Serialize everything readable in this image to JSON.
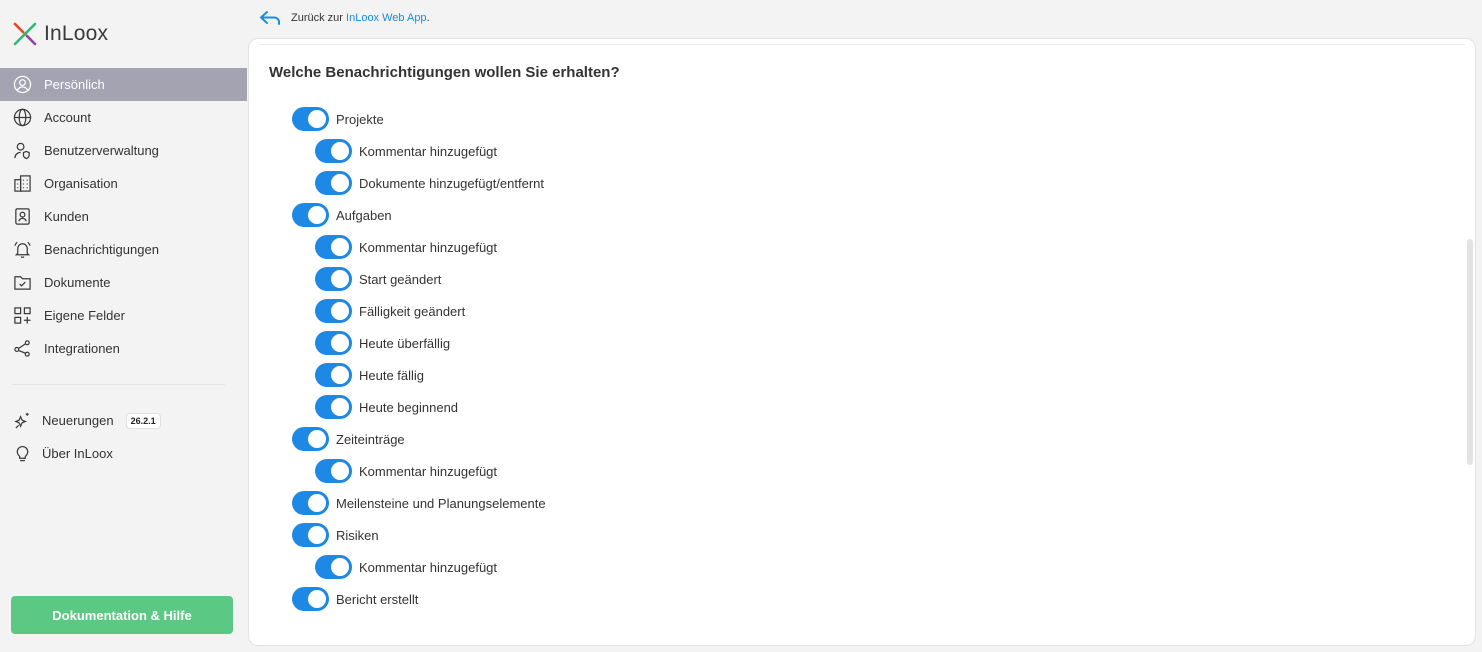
{
  "app": {
    "logo_text": "InLoox"
  },
  "back_link": {
    "prefix": "Zurück zur",
    "link": "InLoox Web App",
    "suffix": "."
  },
  "sidebar": {
    "items": [
      {
        "label": "Persönlich",
        "icon": "user-circle-icon",
        "active": true
      },
      {
        "label": "Account",
        "icon": "globe-icon"
      },
      {
        "label": "Benutzerverwaltung",
        "icon": "user-shield-icon"
      },
      {
        "label": "Organisation",
        "icon": "building-icon"
      },
      {
        "label": "Kunden",
        "icon": "contact-book-icon"
      },
      {
        "label": "Benachrichtigungen",
        "icon": "bell-icon"
      },
      {
        "label": "Dokumente",
        "icon": "folder-check-icon"
      },
      {
        "label": "Eigene Felder",
        "icon": "grid-plus-icon"
      },
      {
        "label": "Integrationen",
        "icon": "share-nodes-icon"
      }
    ],
    "extra": [
      {
        "label": "Neuerungen",
        "icon": "sparkle-icon",
        "badge": "26.2.1"
      },
      {
        "label": "Über InLoox",
        "icon": "lightbulb-icon"
      }
    ],
    "help_button": "Dokumentation & Hilfe"
  },
  "main": {
    "title": "Welche Benachrichtigungen wollen Sie erhalten?",
    "toggles": [
      {
        "label": "Projekte",
        "level": 0,
        "on": true
      },
      {
        "label": "Kommentar hinzugefügt",
        "level": 1,
        "on": true
      },
      {
        "label": "Dokumente hinzugefügt/entfernt",
        "level": 1,
        "on": true
      },
      {
        "label": "Aufgaben",
        "level": 0,
        "on": true
      },
      {
        "label": "Kommentar hinzugefügt",
        "level": 1,
        "on": true
      },
      {
        "label": "Start geändert",
        "level": 1,
        "on": true
      },
      {
        "label": "Fälligkeit geändert",
        "level": 1,
        "on": true
      },
      {
        "label": "Heute überfällig",
        "level": 1,
        "on": true
      },
      {
        "label": "Heute fällig",
        "level": 1,
        "on": true
      },
      {
        "label": "Heute beginnend",
        "level": 1,
        "on": true
      },
      {
        "label": "Zeiteinträge",
        "level": 0,
        "on": true
      },
      {
        "label": "Kommentar hinzugefügt",
        "level": 1,
        "on": true
      },
      {
        "label": "Meilensteine und Planungselemente",
        "level": 0,
        "on": true
      },
      {
        "label": "Risiken",
        "level": 0,
        "on": true
      },
      {
        "label": "Kommentar hinzugefügt",
        "level": 1,
        "on": true
      },
      {
        "label": "Bericht erstellt",
        "level": 0,
        "on": true
      }
    ]
  },
  "colors": {
    "accent": "#1e88e5",
    "active_nav": "#a3a3b2",
    "help_button": "#5bc984",
    "link": "#1a8de0"
  }
}
